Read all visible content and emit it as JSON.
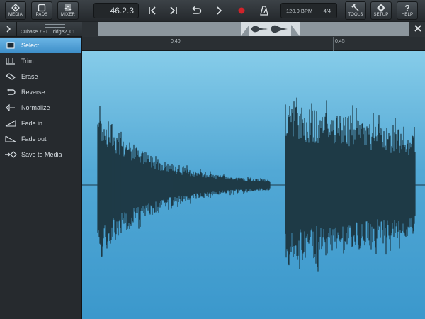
{
  "toolbar": {
    "media_label": "MEDIA",
    "pads_label": "PADS",
    "mixer_label": "MIXER",
    "position": "46.2.3",
    "tempo": "120.0 BPM",
    "time_signature": "4/4",
    "tools_label": "TOOLS",
    "setup_label": "SETUP",
    "help_label": "HELP",
    "record_color": "#d0232a"
  },
  "clip": {
    "name": "Cubase 7 - L...ridge2_01"
  },
  "ruler": {
    "marks": [
      "0:40",
      "0:45"
    ]
  },
  "sidebar": {
    "items": [
      {
        "label": "Select",
        "icon": "select-icon",
        "active": true
      },
      {
        "label": "Trim",
        "icon": "trim-icon",
        "active": false
      },
      {
        "label": "Erase",
        "icon": "erase-icon",
        "active": false
      },
      {
        "label": "Reverse",
        "icon": "reverse-icon",
        "active": false
      },
      {
        "label": "Normalize",
        "icon": "normalize-icon",
        "active": false
      },
      {
        "label": "Fade in",
        "icon": "fade-in-icon",
        "active": false
      },
      {
        "label": "Fade out",
        "icon": "fade-out-icon",
        "active": false
      },
      {
        "label": "Save to Media",
        "icon": "save-to-media-icon",
        "active": false
      }
    ]
  },
  "colors": {
    "accent": "#4a9fd8",
    "waveform": "#1e3a47"
  }
}
